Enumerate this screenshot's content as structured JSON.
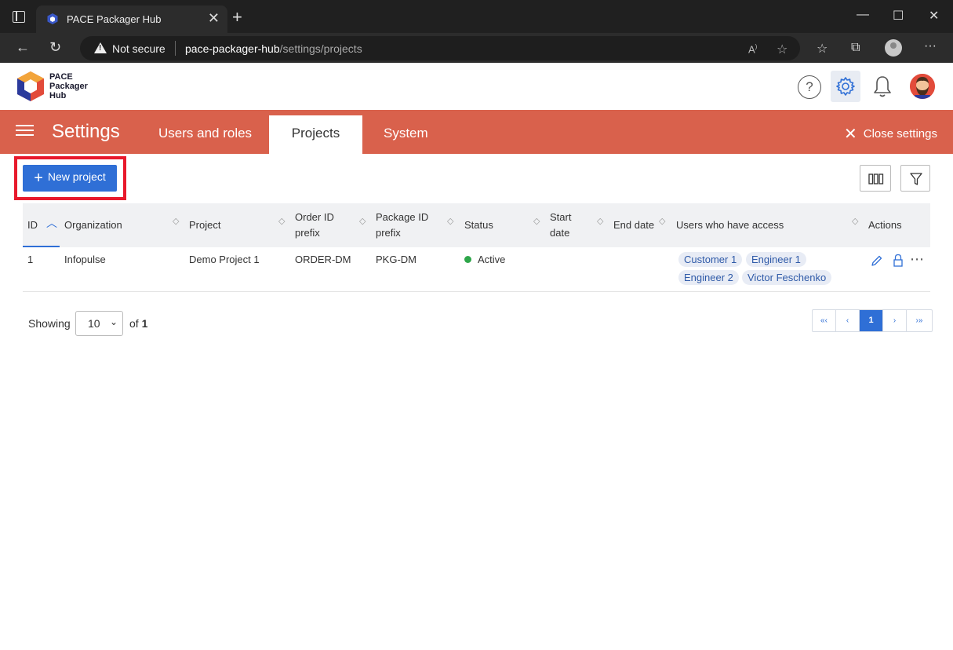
{
  "browser": {
    "tab_title": "PACE Packager Hub",
    "not_secure": "Not secure",
    "url_host": "pace-packager-hub",
    "url_path": "/settings/projects",
    "tab_close": "✕",
    "new_tab": "+",
    "minimize": "—",
    "maximize": "☐",
    "close": "✕",
    "back": "←",
    "refresh": "↻"
  },
  "app": {
    "logo_line1": "PACE",
    "logo_line2": "Packager",
    "logo_line3": "Hub",
    "help": "?",
    "accent_color": "#2f6fd6",
    "bar_color": "#d9614c"
  },
  "settings": {
    "title": "Settings",
    "tabs": [
      {
        "label": "Users and roles"
      },
      {
        "label": "Projects"
      },
      {
        "label": "System"
      }
    ],
    "active_tab": "Projects",
    "close_label": "Close settings"
  },
  "toolbar": {
    "new_project_label": "New project"
  },
  "table": {
    "columns": [
      {
        "label": "ID"
      },
      {
        "label": "Organization"
      },
      {
        "label": "Project"
      },
      {
        "label": "Order ID prefix"
      },
      {
        "label": "Package ID prefix"
      },
      {
        "label": "Status"
      },
      {
        "label": "Start date"
      },
      {
        "label": "End date"
      },
      {
        "label": "Users who have access"
      },
      {
        "label": "Actions"
      }
    ],
    "rows": [
      {
        "id": "1",
        "organization": "Infopulse",
        "project": "Demo Project 1",
        "order_prefix": "ORDER-DM",
        "package_prefix": "PKG-DM",
        "status": "Active",
        "start_date": "",
        "end_date": "",
        "users": [
          "Customer 1",
          "Engineer 1",
          "Engineer 2",
          "Victor Feschenko"
        ]
      }
    ]
  },
  "pagination": {
    "showing_label": "Showing",
    "page_size": "10",
    "of_label": "of",
    "total_pages": "1",
    "first": "«‹",
    "prev": "‹",
    "current": "1",
    "next": "›",
    "last": "›»"
  }
}
